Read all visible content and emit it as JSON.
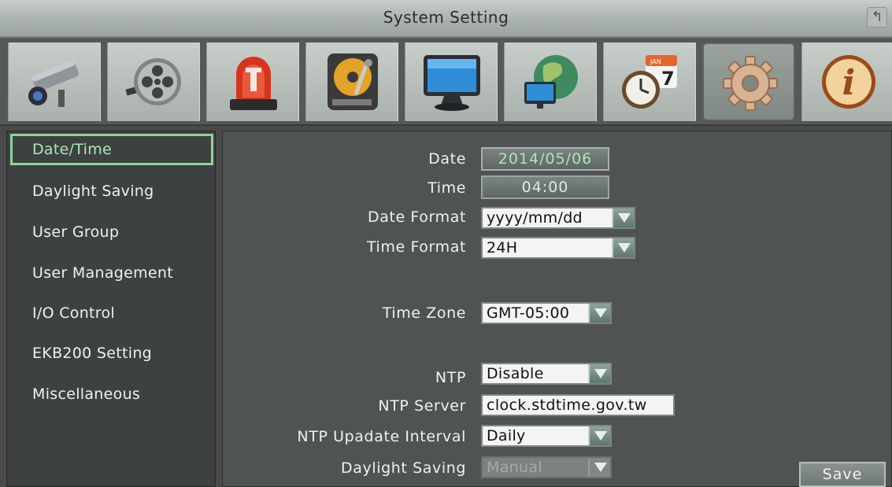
{
  "window": {
    "title": "System Setting",
    "back_icon": "↰"
  },
  "categories": [
    {
      "icon": "camera-icon"
    },
    {
      "icon": "film-reel-icon"
    },
    {
      "icon": "alarm-light-icon"
    },
    {
      "icon": "hard-disk-icon"
    },
    {
      "icon": "monitor-icon"
    },
    {
      "icon": "network-globe-icon"
    },
    {
      "icon": "clock-calendar-icon",
      "calendar_month": "JAN",
      "calendar_day": "7"
    },
    {
      "icon": "gear-icon",
      "active": true
    },
    {
      "icon": "info-icon",
      "letter": "i"
    }
  ],
  "sidebar": {
    "items": [
      {
        "label": "Date/Time",
        "active": true
      },
      {
        "label": "Daylight Saving"
      },
      {
        "label": "User Group"
      },
      {
        "label": "User Management"
      },
      {
        "label": "I/O Control"
      },
      {
        "label": "EKB200 Setting"
      },
      {
        "label": "Miscellaneous"
      }
    ]
  },
  "form": {
    "date": {
      "label": "Date",
      "value": "2014/05/06"
    },
    "time": {
      "label": "Time",
      "value": "04:00"
    },
    "date_format": {
      "label": "Date Format",
      "value": "yyyy/mm/dd"
    },
    "time_format": {
      "label": "Time Format",
      "value": "24H"
    },
    "time_zone": {
      "label": "Time Zone",
      "value": "GMT-05:00"
    },
    "ntp": {
      "label": "NTP",
      "value": "Disable"
    },
    "ntp_server": {
      "label": "NTP Server",
      "value": "clock.stdtime.gov.tw"
    },
    "ntp_interval": {
      "label": "NTP Upadate Interval",
      "value": "Daily"
    },
    "daylight_saving": {
      "label": "Daylight Saving",
      "value": "Manual"
    },
    "save_label": "Save"
  },
  "colors": {
    "accent_green": "#a9e8b2",
    "panel_bg": "#505354",
    "title_bar": "#aab2ad"
  }
}
